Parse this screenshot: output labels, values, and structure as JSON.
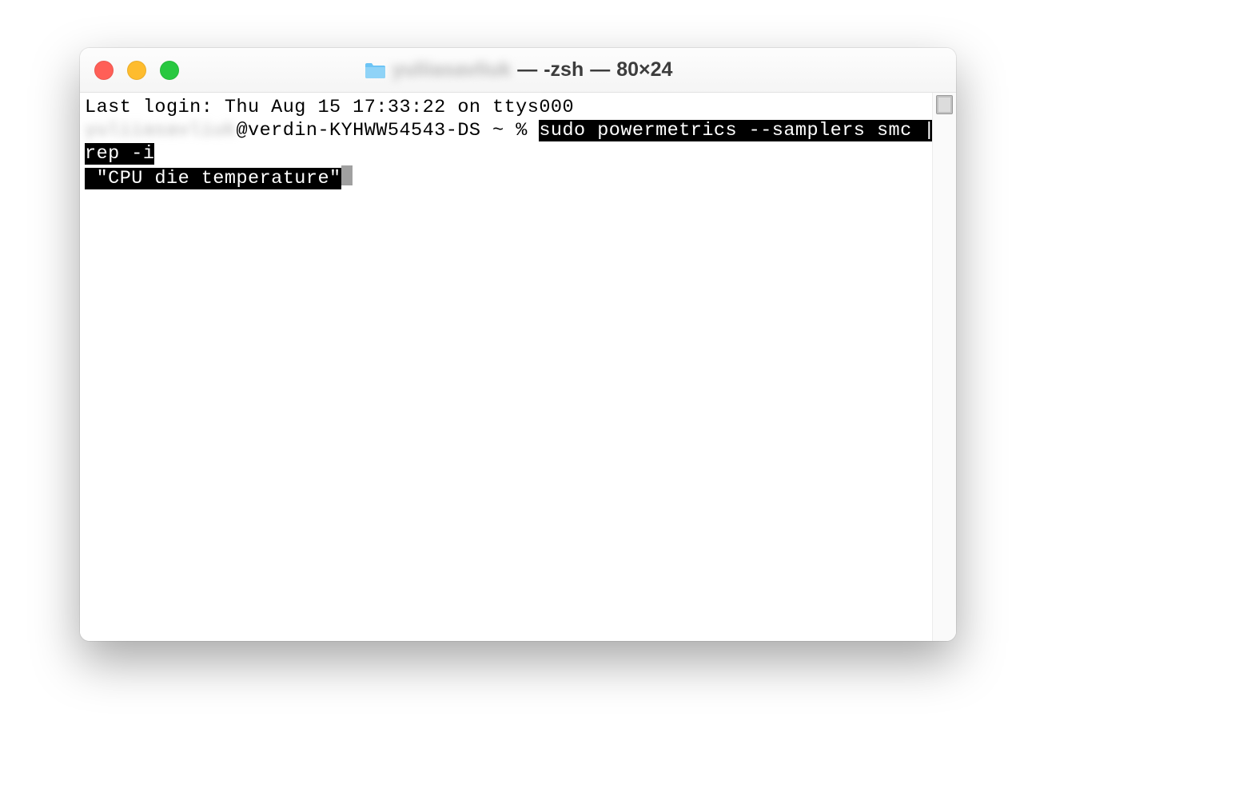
{
  "titlebar": {
    "username": "yuliiasavliuk",
    "separator1": " — ",
    "shell": "-zsh",
    "separator2": " — ",
    "dimensions": "80×24"
  },
  "terminal": {
    "last_login_line": "Last login: Thu Aug 15 17:33:22 on ttys000",
    "prompt_user": "yuliiasavliuk",
    "prompt_host": "@verdin-KYHWW54543-DS ~ % ",
    "command_part1": "sudo powermetrics --samplers smc |grep -i",
    "command_part2": " \"CPU die temperature\""
  }
}
